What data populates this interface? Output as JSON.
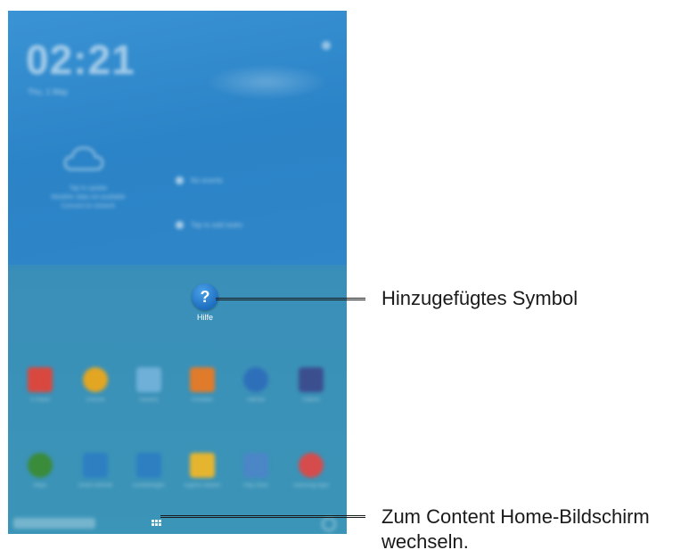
{
  "home_screen": {
    "clock": "02:21",
    "date": "Thu, 1 May",
    "weather_lines": [
      "Tap to update",
      "Weather data not available",
      "Connect to network"
    ],
    "side_items": [
      "No events",
      "Tap to add tasks"
    ],
    "help_app": {
      "glyph": "?",
      "label": "Hilfe"
    },
    "app_rows": [
      [
        {
          "icon": "calendar-icon",
          "color": "#d9483f",
          "label": "S Planer"
        },
        {
          "icon": "chrome-icon",
          "color": "#e2a623",
          "label": "Chrome"
        },
        {
          "icon": "camera-icon",
          "color": "#6fb0d8",
          "label": "Kamera"
        },
        {
          "icon": "contacts-icon",
          "color": "#e07b2b",
          "label": "Kontakte"
        },
        {
          "icon": "internet-icon",
          "color": "#2e6fb9",
          "label": "Internet"
        },
        {
          "icon": "gallery-icon",
          "color": "#3b4f8f",
          "label": "Galerie"
        }
      ],
      [
        {
          "icon": "maps-icon",
          "color": "#3a8b3a",
          "label": "Maps"
        },
        {
          "icon": "smart-remote-icon",
          "color": "#2d7fc2",
          "label": "Smart Remote"
        },
        {
          "icon": "settings-icon",
          "color": "#2d7fc2",
          "label": "Einstellungen"
        },
        {
          "icon": "my-files-icon",
          "color": "#e6b530",
          "label": "Eigene Dateien"
        },
        {
          "icon": "play-store-icon",
          "color": "#4b86c7",
          "label": "Play Store"
        },
        {
          "icon": "pokemon-icon",
          "color": "#d64c4c",
          "label": "Samsung Apps"
        }
      ]
    ]
  },
  "callouts": {
    "added_icon": "Hinzugefügtes Symbol",
    "content_home_line1": "Zum Content Home-Bildschirm",
    "content_home_line2": "wechseln."
  },
  "colors": {
    "screen_blue": "#2b84c7",
    "help_blue": "#1e6fc0",
    "callout_text": "#1a1a1a"
  }
}
